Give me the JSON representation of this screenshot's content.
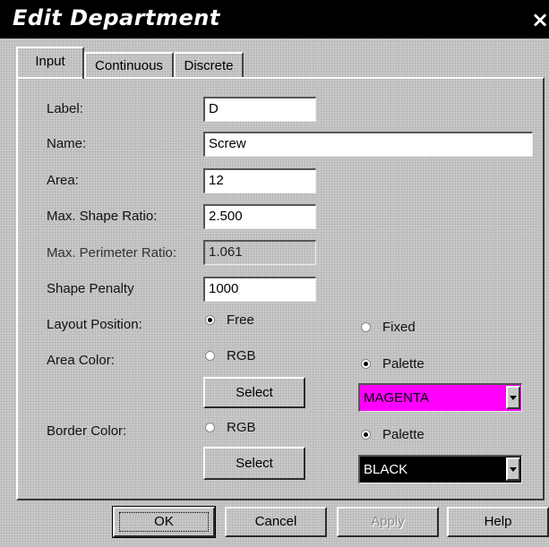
{
  "window": {
    "title": "Edit Department",
    "close_label": "×"
  },
  "tabs": [
    {
      "label": "Input",
      "active": true
    },
    {
      "label": "Continuous",
      "active": false
    },
    {
      "label": "Discrete",
      "active": false
    }
  ],
  "form": {
    "label": {
      "caption": "Label:",
      "value": "D"
    },
    "name": {
      "caption": "Name:",
      "value": "Screw"
    },
    "area": {
      "caption": "Area:",
      "value": "12"
    },
    "max_shape_ratio": {
      "caption": "Max. Shape Ratio:",
      "value": "2.500"
    },
    "max_perimeter_ratio": {
      "caption": "Max. Perimeter Ratio:",
      "value": "1.061"
    },
    "shape_penalty": {
      "caption": "Shape Penalty",
      "value": "1000"
    },
    "layout_position": {
      "caption": "Layout Position:",
      "options": [
        {
          "label": "Free",
          "selected": true
        },
        {
          "label": "Fixed",
          "selected": false
        }
      ]
    },
    "area_color": {
      "caption": "Area Color:",
      "rgb_label": "RGB",
      "rgb_selected": false,
      "palette_label": "Palette",
      "palette_selected": true,
      "select_label": "Select",
      "palette_value": "MAGENTA",
      "palette_bg": "#ff00ff",
      "palette_fg": "#000000"
    },
    "border_color": {
      "caption": "Border Color:",
      "rgb_label": "RGB",
      "rgb_selected": false,
      "palette_label": "Palette",
      "palette_selected": true,
      "select_label": "Select",
      "palette_value": "BLACK",
      "palette_bg": "#000000",
      "palette_fg": "#ffffff"
    }
  },
  "footer": {
    "ok_label": "OK",
    "cancel_label": "Cancel",
    "apply_label": "Apply",
    "help_label": "Help"
  },
  "colors": {
    "dialog_bg": "#c8c8c8",
    "title_bg": "#000000",
    "title_fg": "#ffffff"
  }
}
